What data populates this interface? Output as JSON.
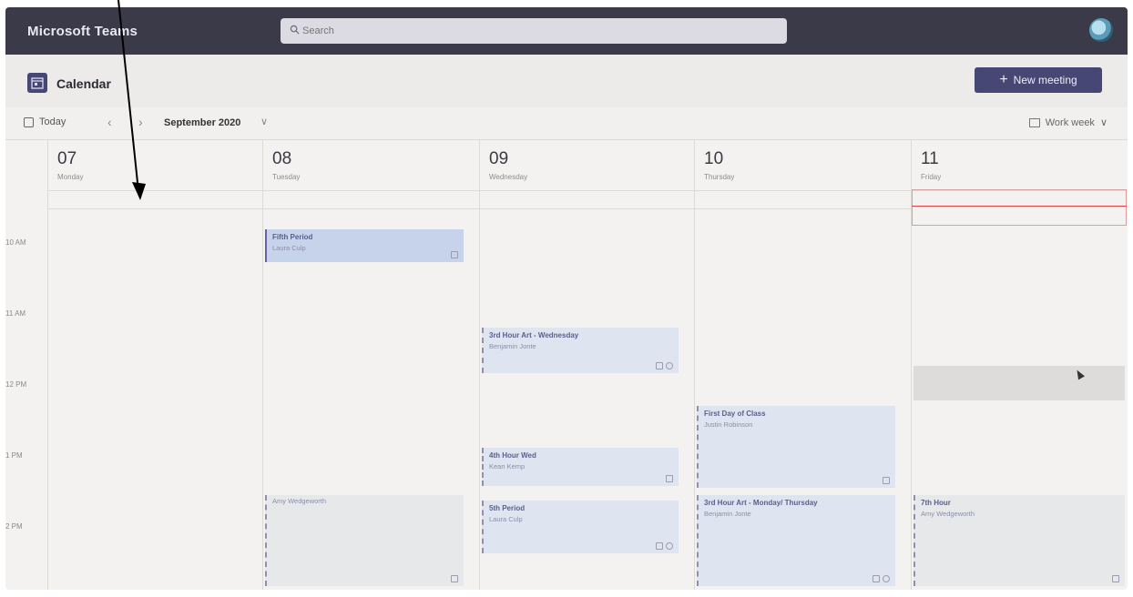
{
  "app": {
    "title": "Microsoft Teams"
  },
  "search": {
    "placeholder": "Search"
  },
  "calendar": {
    "title": "Calendar",
    "new_meeting_label": "New meeting"
  },
  "toolbar": {
    "today_label": "Today",
    "month_label": "September 2020",
    "view_label": "Work week"
  },
  "time_labels": [
    "10 AM",
    "11 AM",
    "12 PM",
    "1 PM",
    "2 PM"
  ],
  "days": [
    {
      "num": "07",
      "name": "Monday"
    },
    {
      "num": "08",
      "name": "Tuesday"
    },
    {
      "num": "09",
      "name": "Wednesday"
    },
    {
      "num": "10",
      "name": "Thursday"
    },
    {
      "num": "11",
      "name": "Friday"
    }
  ],
  "events": [
    {
      "title": "Fifth Period",
      "organizer": "Laura Culp"
    },
    {
      "title": "3rd Hour Art - Wednesday",
      "organizer": "Benjamin Jonte"
    },
    {
      "title": "4th Hour Wed",
      "organizer": "Kean Kemp"
    },
    {
      "title": "5th Period",
      "organizer": "Laura Culp"
    },
    {
      "title": "",
      "organizer": "Amy Wedgeworth"
    },
    {
      "title": "First Day of Class",
      "organizer": "Justin Robinson"
    },
    {
      "title": "3rd Hour Art - Monday/ Thursday",
      "organizer": "Benjamin Jonte"
    },
    {
      "title": "7th Hour",
      "organizer": "Amy Wedgeworth"
    }
  ],
  "colors": {
    "titlebar": "#3b3a48",
    "accent": "#464775",
    "event": "#dfe5f0",
    "now_line": "#dd4444"
  }
}
